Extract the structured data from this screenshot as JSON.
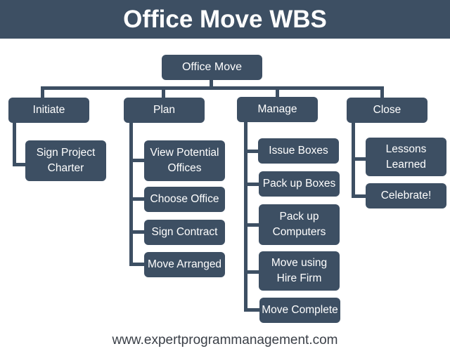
{
  "header": {
    "title": "Office Move WBS"
  },
  "root": {
    "label": "Office Move"
  },
  "phases": [
    {
      "label": "Initiate",
      "children": [
        "Sign Project Charter"
      ]
    },
    {
      "label": "Plan",
      "children": [
        "View Potential Offices",
        "Choose Office",
        "Sign Contract",
        "Move Arranged"
      ]
    },
    {
      "label": "Manage",
      "children": [
        "Issue Boxes",
        "Pack up Boxes",
        "Pack up Computers",
        "Move using Hire Firm",
        "Move Complete"
      ]
    },
    {
      "label": "Close",
      "children": [
        "Lessons Learned",
        "Celebrate!"
      ]
    }
  ],
  "footer": {
    "url": "www.expertprogrammanagement.com"
  },
  "colors": {
    "box": "#3d4f63",
    "text": "#ffffff",
    "footer_text": "#3a3f47"
  }
}
